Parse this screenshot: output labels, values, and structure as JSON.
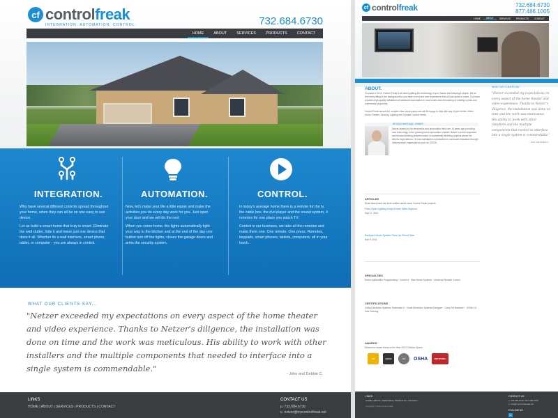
{
  "brand": {
    "name_a": "control",
    "name_b": "freak",
    "tagline": "INTEGRATION. AUTOMATION. CONTROL.",
    "accent": "#1a8fd3",
    "dark": "#3a3d40"
  },
  "home": {
    "phone": "732.684.6730",
    "nav": [
      "HOME",
      "ABOUT",
      "SERVICES",
      "PRODUCTS",
      "CONTACT"
    ],
    "features": [
      {
        "icon": "circuit-icon",
        "title": "INTEGRATION.",
        "p1": "Why have several different controls spread throughout your home, when they can all be on one easy to use device.",
        "p2": "Let us build a smart home that truly is smart. Eliminate the wall clutter, hide it and leave just one device that does it all. Whether its a wall interface, smart phone, tablet, or computer - you are always in control."
      },
      {
        "icon": "lightbulb-icon",
        "title": "AUTOMATION.",
        "p1": "Now, let's make your life a little easier and make the activities you do every day work for you. Just open your door and we will do the rest.",
        "p2": "When you come home, the lights automatically light your way to the kitchen and at the end of the day one button turn off the lights, closes the garage doors and arms the security system."
      },
      {
        "icon": "play-icon",
        "title": "CONTROL.",
        "p1": "In today's average home there is a remote for the tv, the cable box, the dvd player and the sound system, 4 remotes for one place you watch TV.",
        "p2": "Control is our business, we take all the remotes and make them one. One remote, One press. Remotes, keypads, smart phones, tablets, computers, all in your touch."
      }
    ],
    "testimonial": {
      "label": "WHAT OUR CLIENTS SAY...",
      "quote": "\"Netzer exceeded my expectations on every aspect of the home theater and video experience. Thanks to Netzer's diligence, the installation was done on time and the work was meticulous. His ability to work with other installers and the multiple components that needed to interface into a single system is commendable.\"",
      "cite": "- John and Debbie C."
    },
    "footer": {
      "links_title": "LINKS",
      "links": "HOME | ABOUT | SERVICES | PRODUCTS | CONTACT",
      "contact_title": "CONTACT US",
      "phone": "p. 732.684.6730",
      "email": "e. netzer@mycontrolfreak.net"
    }
  },
  "about": {
    "phone1": "732.684.6730",
    "phone2": "877.486.1005",
    "nav": [
      "HOME",
      "ABOUT",
      "SERVICES",
      "PRODUCTS",
      "CONTACT"
    ],
    "title": "ABOUT.",
    "intro1": "Founded in 2011, Control Freak is all about getting the technology in your hands and keeping it simple. We do the heavy lifting in the background so you have a next-one user experience that will last years to come. Our team provides high quality installation of advanced automation in new homes and remodeling of existing homes and commercial properties.",
    "intro2": "Control Freak serves the northern New Jersey area and will be happy to help with any of your Audio, Video, Home Theater, Security, Lighting and Climate Control needs.",
    "bio_head": "NETZER MARTINEZ, OWNER",
    "bio": "Netzer started in the electronics and automation field over 10 years ago providing new technology to the growing home automation market. Netzer is a self-respected and forward thinking problem solver in consistently finishing projects above his client's expectations. He has maintained a dedication to continued education through industry trade organizations such as CEDIA.",
    "testimonial_label": "WHAT OUR CLIENTS SAY...",
    "testimonial": "\"Netzer exceeded my expectations on every aspect of the home theater and video experience. Thanks to Netzer's diligence, the installation was done on time and the work was meticulous. His ability to work with other installers and the multiple components that needed to interface into a single system is commendable.\"",
    "testimonial_cite": "- John and Debbie C.",
    "articles_title": "ARTICLES",
    "articles_sub": "Read about what has been written about some Control Freak projects.",
    "article1": "Fiber-Optic Lighting Keeps Home Safer Improve",
    "article1_date": "Sep 17, 2011",
    "article2": "Backyard Music System Picks Up Period Sale",
    "article2_date": "Sep 9, 2011",
    "specialties_title": "SPECIALTIES",
    "specialties": "Home Automation Programming · Control 4 · Elan Home Systems · Universal Remote Control",
    "certs_title": "CERTIFICATIONS",
    "certs": "Cedia Electronic Systems Technician II · Cedia Electronic Systems Designer · CompTIA Network+ · OSHA 10-hour Training",
    "awards_title": "AWARDS",
    "awards": "Electronic House Home of the Year 2010 Outdoor Space",
    "badges": [
      "EH",
      "CEDIA",
      "C4",
      "OSHA",
      "NETWORK+"
    ],
    "footer": {
      "links_title": "LINKS",
      "links": "HOME | ABOUT | SERVICES | PRODUCTS | CONTACT",
      "copyright": "Copyright © 2012 Control Freak",
      "contact_title": "CONTACT US",
      "phone": "p. 732.684.6730 / 877.486.1005",
      "email": "e. info@mycontrolfreak.net",
      "follow": "FOLLOW US",
      "linkedin": "in"
    }
  }
}
